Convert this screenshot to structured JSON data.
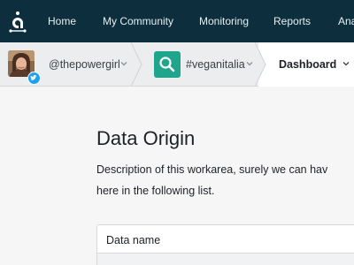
{
  "topnav": {
    "items": [
      {
        "label": "Home"
      },
      {
        "label": "My Community"
      },
      {
        "label": "Monitoring"
      },
      {
        "label": "Reports"
      },
      {
        "label": "Ana"
      }
    ]
  },
  "context": {
    "account": "@thepowergirl",
    "topic": "#veganitalia",
    "view": "Dashboard"
  },
  "main": {
    "title": "Data Origin",
    "description_lines": [
      "Description of this workarea, surely we can hav",
      "here in the following list."
    ],
    "table": {
      "columns": [
        "Data name"
      ]
    }
  },
  "colors": {
    "nav_bg": "#0d2f3d",
    "accent": "#1fa58b",
    "twitter": "#1da1f2"
  }
}
